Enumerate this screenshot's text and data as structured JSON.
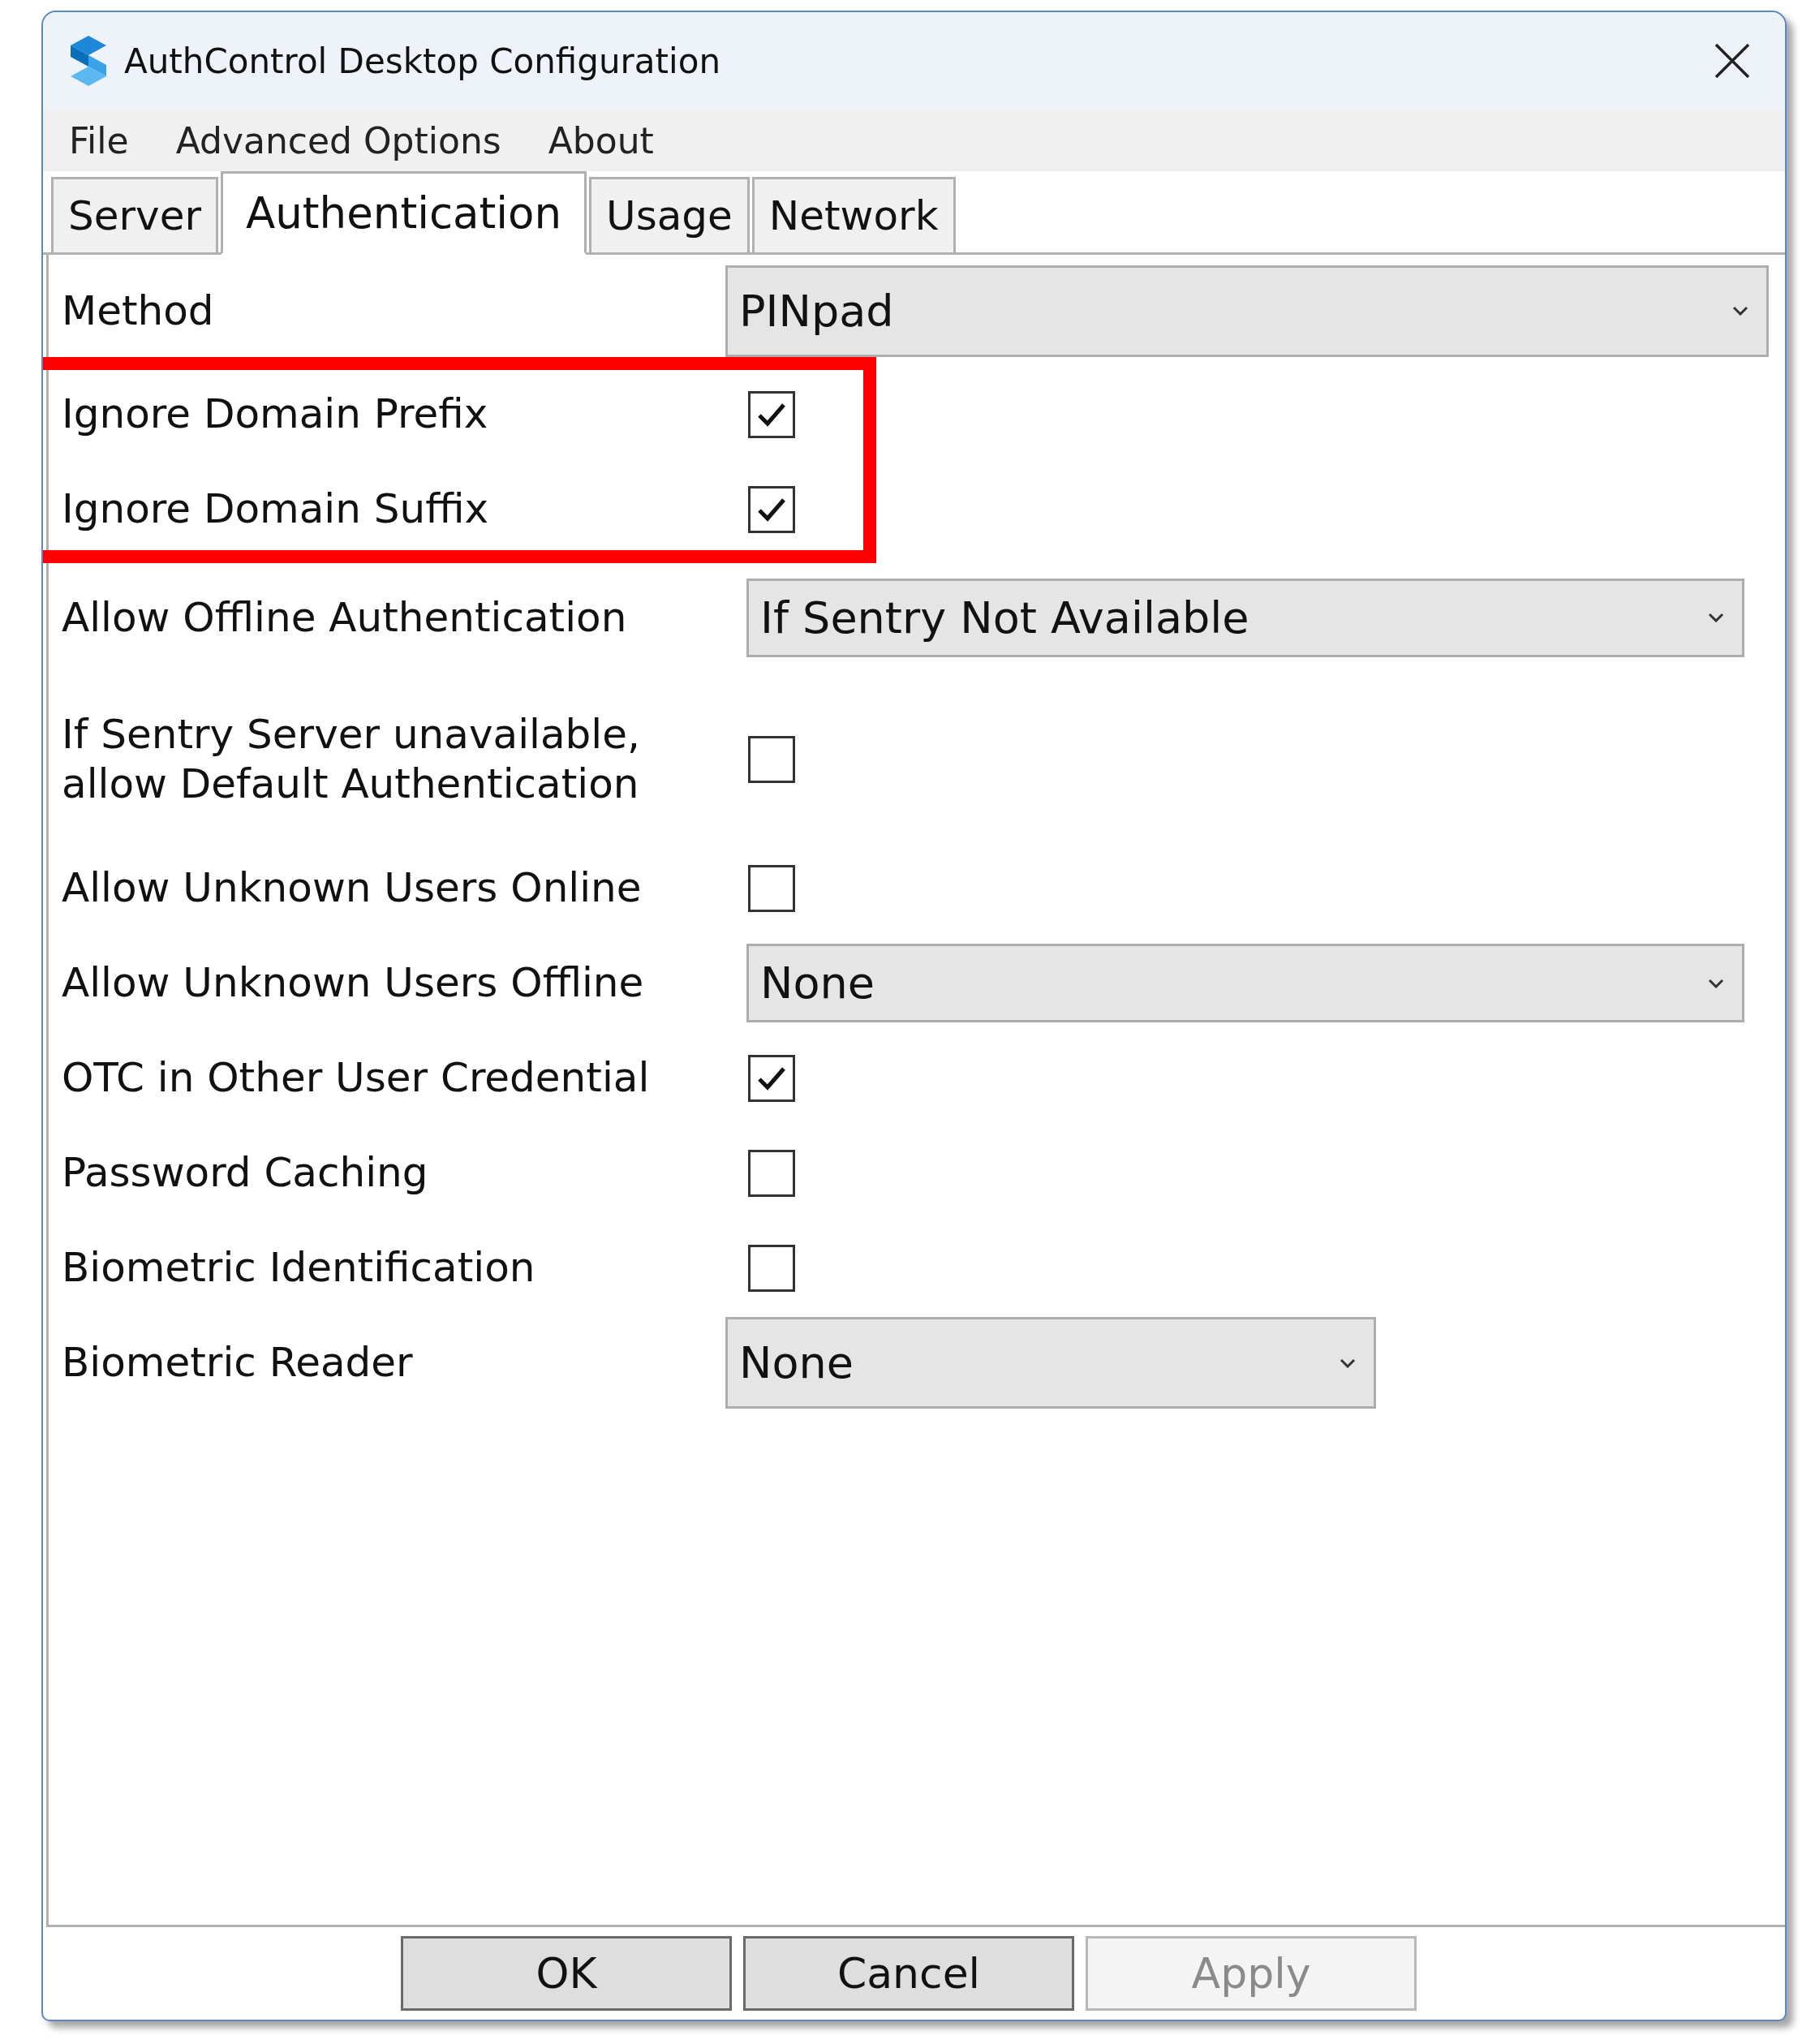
{
  "window": {
    "title": "AuthControl Desktop Configuration"
  },
  "menu": [
    "File",
    "Advanced Options",
    "About"
  ],
  "tabs": [
    {
      "label": "Server",
      "selected": false
    },
    {
      "label": "Authentication",
      "selected": true
    },
    {
      "label": "Usage",
      "selected": false
    },
    {
      "label": "Network",
      "selected": false
    }
  ],
  "rows": [
    {
      "kind": "dropdown",
      "label": "Method",
      "value": "PINpad",
      "highlighted": false
    },
    {
      "kind": "checkbox",
      "label": "Ignore Domain Prefix",
      "checked": true,
      "highlighted": true
    },
    {
      "kind": "checkbox",
      "label": "Ignore Domain Suffix",
      "checked": true,
      "highlighted": true
    },
    {
      "kind": "dropdown",
      "label": "Allow Offline Authentication",
      "value": "If Sentry Not Available",
      "highlighted": false
    },
    {
      "kind": "checkbox",
      "label": "If Sentry Server unavailable, allow Default Authentication",
      "checked": false,
      "highlighted": false
    },
    {
      "kind": "checkbox",
      "label": "Allow Unknown Users Online",
      "checked": false,
      "highlighted": false
    },
    {
      "kind": "dropdown",
      "label": "Allow Unknown Users Offline",
      "value": "None",
      "highlighted": false
    },
    {
      "kind": "checkbox",
      "label": "OTC in Other User Credential",
      "checked": true,
      "highlighted": false
    },
    {
      "kind": "checkbox",
      "label": "Password Caching",
      "checked": false,
      "highlighted": false
    },
    {
      "kind": "checkbox",
      "label": "Biometric Identification",
      "checked": false,
      "highlighted": false
    },
    {
      "kind": "dropdown",
      "label": "Biometric Reader",
      "value": "None",
      "highlighted": false
    }
  ],
  "buttons": [
    {
      "label": "OK",
      "disabled": false
    },
    {
      "label": "Cancel",
      "disabled": false
    },
    {
      "label": "Apply",
      "disabled": true
    }
  ]
}
